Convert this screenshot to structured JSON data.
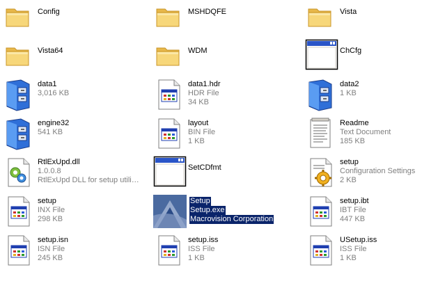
{
  "colors": {
    "selection_bg": "#0a246a",
    "selection_text": "#ffffff",
    "secondary_text": "#7f7f7f",
    "folder": "#f4d06a"
  },
  "items": [
    {
      "name": "Config",
      "icon": "folder-icon",
      "selected": false
    },
    {
      "name": "MSHDQFE",
      "icon": "folder-icon",
      "selected": false
    },
    {
      "name": "Vista",
      "icon": "folder-icon",
      "selected": false
    },
    {
      "name": "Vista64",
      "icon": "folder-icon",
      "selected": false
    },
    {
      "name": "WDM",
      "icon": "folder-icon",
      "selected": false
    },
    {
      "name": "ChCfg",
      "icon": "application-window-icon",
      "selected": false
    },
    {
      "name": "data1",
      "sub1": "3,016 KB",
      "icon": "installer-cabinet-icon",
      "selected": false
    },
    {
      "name": "data1.hdr",
      "sub1": "HDR File",
      "sub2": "34 KB",
      "icon": "generic-file-icon",
      "selected": false
    },
    {
      "name": "data2",
      "sub1": "1 KB",
      "icon": "installer-cabinet-icon",
      "selected": false
    },
    {
      "name": "engine32",
      "sub1": "541 KB",
      "icon": "installer-cabinet-icon",
      "selected": false
    },
    {
      "name": "layout",
      "sub1": "BIN File",
      "sub2": "1 KB",
      "icon": "generic-file-icon",
      "selected": false
    },
    {
      "name": "Readme",
      "sub1": "Text Document",
      "sub2": "185 KB",
      "icon": "text-document-icon",
      "selected": false
    },
    {
      "name": "RtlExUpd.dll",
      "sub1": "1.0.0.8",
      "sub2": "RtlExUpd DLL for setup utility ...",
      "icon": "dll-gear-icon",
      "selected": false
    },
    {
      "name": "SetCDfmt",
      "icon": "application-window-icon",
      "selected": false
    },
    {
      "name": "setup",
      "sub1": "Configuration Settings",
      "sub2": "2 KB",
      "icon": "config-settings-icon",
      "selected": false
    },
    {
      "name": "setup",
      "sub1": "INX File",
      "sub2": "298 KB",
      "icon": "generic-file-icon",
      "selected": false
    },
    {
      "name": "Setup",
      "sub1": "Setup.exe",
      "sub2": "Macrovision Corporation",
      "icon": "setup-exe-icon",
      "selected": true
    },
    {
      "name": "setup.ibt",
      "sub1": "IBT File",
      "sub2": "447 KB",
      "icon": "generic-file-icon",
      "selected": false
    },
    {
      "name": "setup.isn",
      "sub1": "ISN File",
      "sub2": "245 KB",
      "icon": "generic-file-icon",
      "selected": false
    },
    {
      "name": "setup.iss",
      "sub1": "ISS File",
      "sub2": "1 KB",
      "icon": "generic-file-icon",
      "selected": false
    },
    {
      "name": "USetup.iss",
      "sub1": "ISS File",
      "sub2": "1 KB",
      "icon": "generic-file-icon",
      "selected": false
    }
  ]
}
